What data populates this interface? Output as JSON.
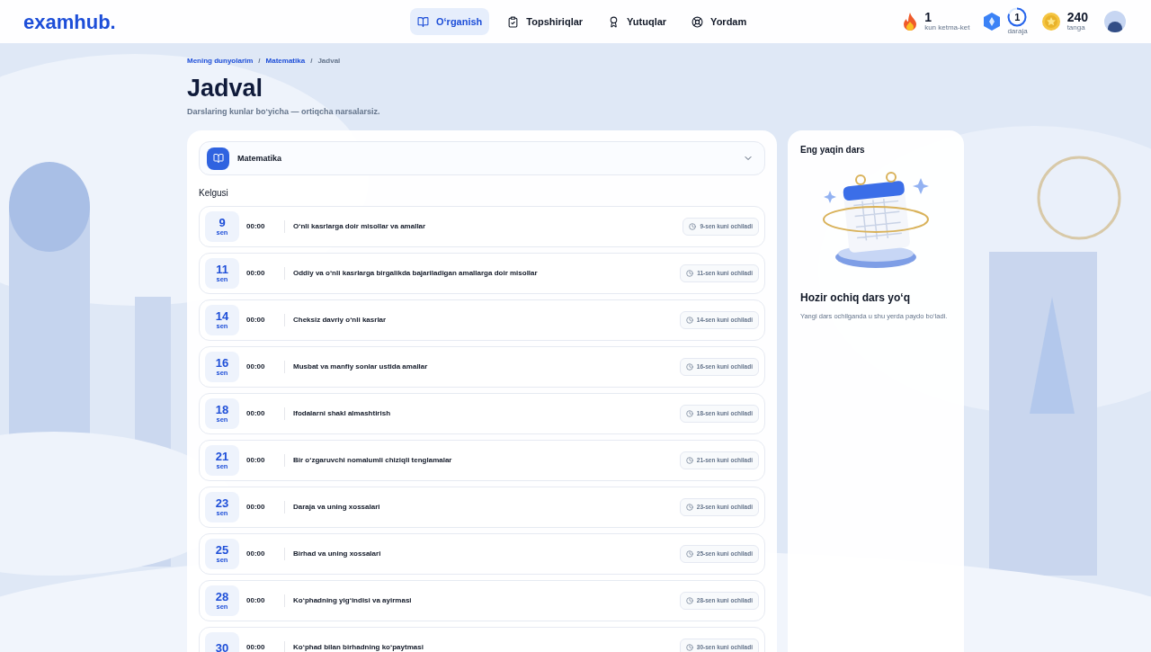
{
  "header": {
    "logo": "examhub.",
    "nav": [
      {
        "label": "O‘rganish",
        "selected": true
      },
      {
        "label": "Topshiriqlar",
        "selected": false
      },
      {
        "label": "Yutuqlar",
        "selected": false
      },
      {
        "label": "Yordam",
        "selected": false
      }
    ],
    "stats": [
      {
        "kind": "streak",
        "value": "1",
        "label": "kun ketma-ket"
      },
      {
        "kind": "level",
        "value": "1",
        "label": "daraja"
      },
      {
        "kind": "coins",
        "value": "240",
        "label": "tanga"
      }
    ]
  },
  "breadcrumb": [
    {
      "label": "Mening dunyolarim",
      "current": false
    },
    {
      "separator": "/",
      "label": "Matematika",
      "current": false
    },
    {
      "separator": "/",
      "label": "Jadval",
      "current": true
    }
  ],
  "title": "Jadval",
  "subtitle": "Darslaring kunlar bo‘yicha — ortiqcha narsalarsiz.",
  "subject_select": {
    "value": "Matematika"
  },
  "section_label": "Kelgusi",
  "lessons": [
    {
      "day": "9",
      "weekday": "sen",
      "time": "00:00",
      "title": "O‘nli kasrlarga doir misollar va amallar",
      "badge": "9-sen kuni ochiladi"
    },
    {
      "day": "11",
      "weekday": "sen",
      "time": "00:00",
      "title": "Oddiy va o‘nli kasrlarga birgalikda bajariladigan amallarga doir misollar",
      "badge": "11-sen kuni ochiladi"
    },
    {
      "day": "14",
      "weekday": "sen",
      "time": "00:00",
      "title": "Cheksiz davriy o‘nli kasrlar",
      "badge": "14-sen kuni ochiladi"
    },
    {
      "day": "16",
      "weekday": "sen",
      "time": "00:00",
      "title": "Musbat va manfiy sonlar ustida amallar",
      "badge": "16-sen kuni ochiladi"
    },
    {
      "day": "18",
      "weekday": "sen",
      "time": "00:00",
      "title": "Ifodalarni shakl almashtirish",
      "badge": "18-sen kuni ochiladi"
    },
    {
      "day": "21",
      "weekday": "sen",
      "time": "00:00",
      "title": "Bir o‘zgaruvchi nomalumli chiziqli tenglamalar",
      "badge": "21-sen kuni ochiladi"
    },
    {
      "day": "23",
      "weekday": "sen",
      "time": "00:00",
      "title": "Daraja va uning xossalari",
      "badge": "23-sen kuni ochiladi"
    },
    {
      "day": "25",
      "weekday": "sen",
      "time": "00:00",
      "title": "Birhad va uning xossalari",
      "badge": "25-sen kuni ochiladi"
    },
    {
      "day": "28",
      "weekday": "sen",
      "time": "00:00",
      "title": "Ko‘phadning yig‘indisi va ayirmasi",
      "badge": "28-sen kuni ochiladi"
    },
    {
      "day": "30",
      "time": "00:00",
      "title": "Ko‘phad bilan birhadning ko‘paytmasi",
      "badge": "30-sen kuni ochiladi"
    }
  ],
  "next_lesson": {
    "title": "Eng yaqin dars",
    "empty_title": "Hozir ochiq dars yo‘q",
    "empty_text": "Yangi dars ochilganda u shu yerda paydo bo‘ladi."
  }
}
